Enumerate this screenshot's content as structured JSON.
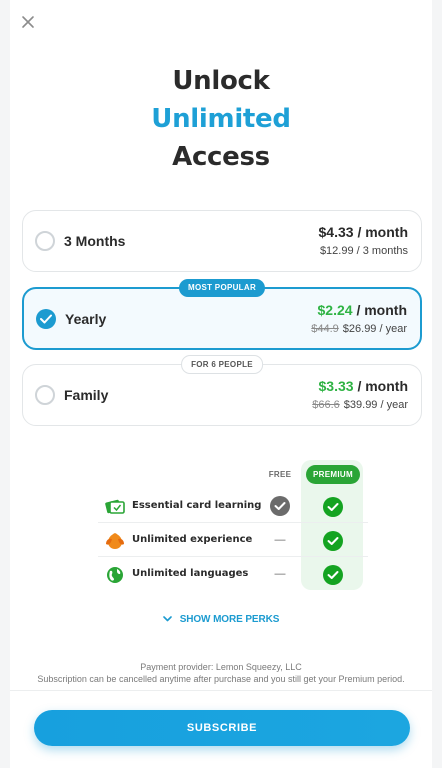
{
  "header": {
    "close_icon": "close-icon",
    "title_line1": "Unlock",
    "title_accent": "Unlimited",
    "title_line3": "Access"
  },
  "colors": {
    "accent": "#1ea0d6",
    "price_green": "#2fb344",
    "premium_green": "#2aa536"
  },
  "plans": [
    {
      "name": "3 Months",
      "price": "$4.33",
      "per": " / month",
      "old_price": "",
      "billing": "$12.99 / 3 months",
      "selected": false,
      "badge": ""
    },
    {
      "name": "Yearly",
      "price": "$2.24",
      "per": " / month",
      "old_price": "$44.9",
      "billing": "$26.99 / year",
      "selected": true,
      "badge": "MOST POPULAR"
    },
    {
      "name": "Family",
      "price": "$3.33",
      "per": " / month",
      "old_price": "$66.6",
      "billing": "$39.99 / year",
      "selected": false,
      "badge": "FOR 6 PEOPLE"
    }
  ],
  "perks": {
    "free_header": "FREE",
    "premium_header": "PREMIUM",
    "rows": [
      {
        "label": "Essential card learning",
        "icon": "cards-icon",
        "free": "check",
        "premium": "check"
      },
      {
        "label": "Unlimited experience",
        "icon": "leaf-icon",
        "free": "—",
        "premium": "check"
      },
      {
        "label": "Unlimited languages",
        "icon": "globe-icon",
        "free": "—",
        "premium": "check"
      }
    ],
    "show_more": "SHOW MORE PERKS"
  },
  "footer": {
    "provider": "Payment provider: Lemon Squeezy, LLC",
    "note": "Subscription can be cancelled anytime after purchase and you still get your Premium period.",
    "subscribe": "SUBSCRIBE"
  }
}
